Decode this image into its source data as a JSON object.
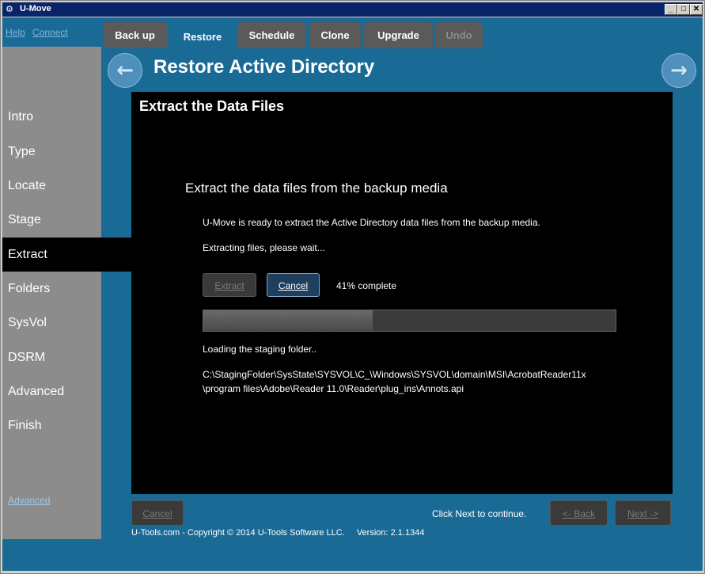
{
  "window": {
    "title": "U-Move",
    "minimize": "_",
    "maximize": "□",
    "close": "✕"
  },
  "top_links": {
    "help": "Help",
    "connect": "Connect"
  },
  "tabs": [
    {
      "label": "Back up",
      "state": "normal"
    },
    {
      "label": "Restore",
      "state": "active"
    },
    {
      "label": "Schedule",
      "state": "normal"
    },
    {
      "label": "Clone",
      "state": "normal"
    },
    {
      "label": "Upgrade",
      "state": "normal"
    },
    {
      "label": "Undo",
      "state": "disabled"
    }
  ],
  "heading": "Restore Active Directory",
  "nav_buttons": {
    "back_icon": "arrow-left-icon",
    "forward_icon": "arrow-right-icon"
  },
  "sidebar": {
    "items": [
      "Intro",
      "Type",
      "Locate",
      "Stage",
      "Extract",
      "Folders",
      "SysVol",
      "DSRM",
      "Advanced",
      "Finish"
    ],
    "active": "Extract",
    "advanced_link": "Advanced"
  },
  "panel": {
    "title": "Extract the Data Files",
    "sub_heading": "Extract the data files from the backup media",
    "ready_text": "U-Move is ready to extract the Active Directory data files from the backup media.",
    "status_text": "Extracting files, please wait...",
    "extract_button": "Extract",
    "cancel_button": "Cancel",
    "percent_text": "41% complete",
    "progress": 0.41,
    "loading_text": "Loading the staging folder..",
    "path_line1": "C:\\StagingFolder\\SysState\\SYSVOL\\C_\\Windows\\SYSVOL\\domain\\MSI\\AcrobatReader11x",
    "path_line2": "\\program files\\Adobe\\Reader 11.0\\Reader\\plug_ins\\Annots.api"
  },
  "bottom": {
    "cancel_button": "Cancel",
    "hint": "Click Next to continue.",
    "back_button": "<- Back",
    "next_button": "Next ->"
  },
  "footer": {
    "copyright": "U-Tools.com - Copyright © 2014 U-Tools Software LLC.",
    "version": "Version: 2.1.1344"
  }
}
